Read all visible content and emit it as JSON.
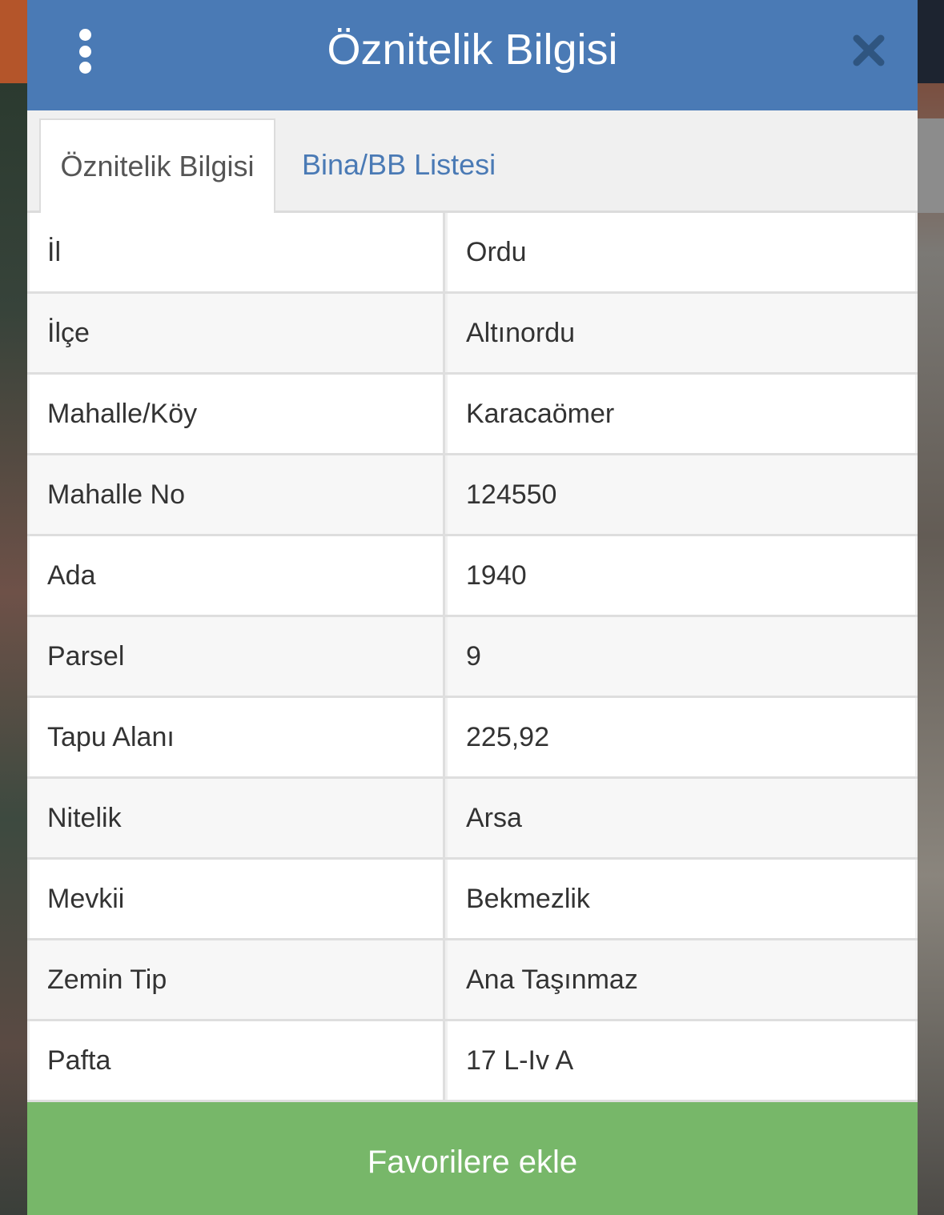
{
  "header": {
    "title": "Öznitelik Bilgisi",
    "menu_icon": "kebab-menu-icon",
    "close_icon": "close-icon",
    "color": "#4a7ab5"
  },
  "tabs": [
    {
      "label": "Öznitelik Bilgisi",
      "active": true
    },
    {
      "label": "Bina/BB Listesi",
      "active": false
    }
  ],
  "attributes": [
    {
      "label": "İl",
      "value": "Ordu"
    },
    {
      "label": "İlçe",
      "value": "Altınordu"
    },
    {
      "label": "Mahalle/Köy",
      "value": "Karacaömer"
    },
    {
      "label": "Mahalle No",
      "value": "124550"
    },
    {
      "label": "Ada",
      "value": "1940"
    },
    {
      "label": "Parsel",
      "value": "9"
    },
    {
      "label": "Tapu Alanı",
      "value": "225,92"
    },
    {
      "label": "Nitelik",
      "value": "Arsa"
    },
    {
      "label": "Mevkii",
      "value": "Bekmezlik"
    },
    {
      "label": "Zemin Tip",
      "value": "Ana Taşınmaz"
    },
    {
      "label": "Pafta",
      "value": "17 L-Iv A"
    }
  ],
  "footer": {
    "favorite_label": "Favorilere ekle",
    "color": "#77b769"
  }
}
